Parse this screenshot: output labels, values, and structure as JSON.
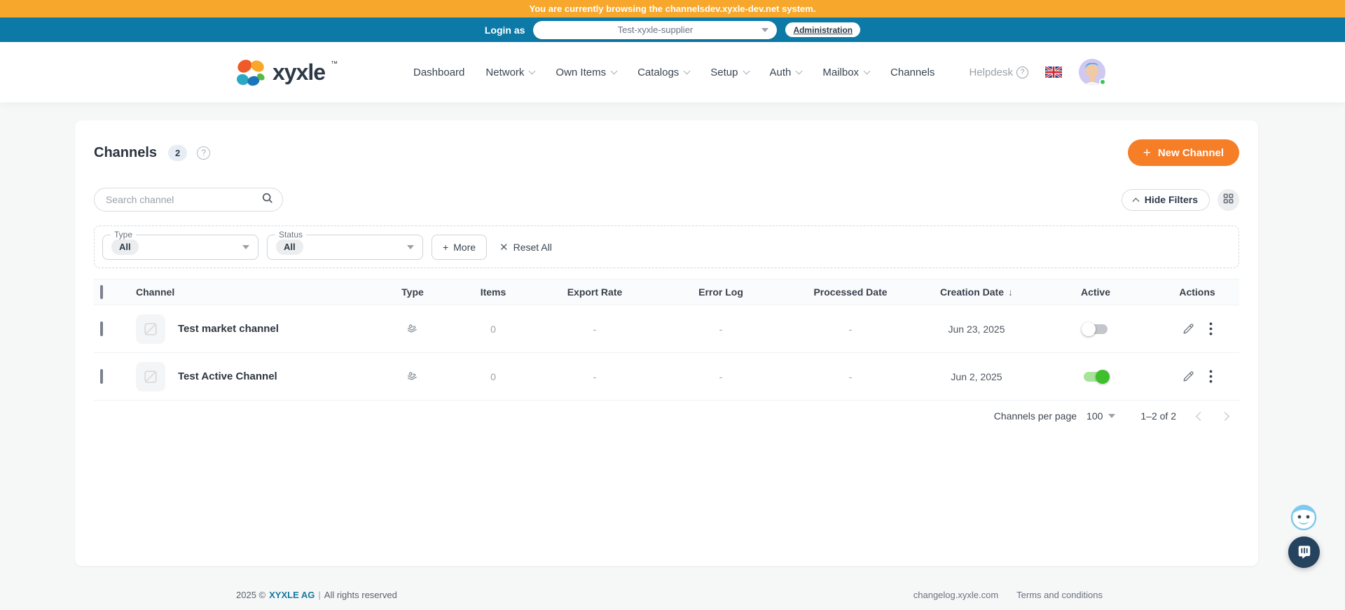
{
  "banner": {
    "text": "You are currently browsing the channelsdev.xyxle-dev.net system."
  },
  "login_bar": {
    "label": "Login as",
    "selected_user": "Test-xyxle-supplier",
    "admin_link": "Administration"
  },
  "header": {
    "logo_text": "xyxle",
    "logo_tm": "™",
    "nav": [
      {
        "label": "Dashboard"
      },
      {
        "label": "Network"
      },
      {
        "label": "Own Items"
      },
      {
        "label": "Catalogs"
      },
      {
        "label": "Setup"
      },
      {
        "label": "Auth"
      },
      {
        "label": "Mailbox"
      },
      {
        "label": "Channels"
      }
    ],
    "helpdesk_label": "Helpdesk"
  },
  "page": {
    "title": "Channels",
    "count_badge": "2"
  },
  "toolbar": {
    "new_channel_label": "New Channel",
    "plus_sign": "+",
    "search_placeholder": "Search channel",
    "hide_filters_label": "Hide Filters"
  },
  "filters": {
    "type_label": "Type",
    "type_value": "All",
    "status_label": "Status",
    "status_value": "All",
    "more_plus": "+",
    "more_label": "More",
    "reset_x": "✕",
    "reset_label": "Reset All"
  },
  "table": {
    "columns": [
      "Channel",
      "Type",
      "Items",
      "Export Rate",
      "Error Log",
      "Processed Date",
      "Creation Date",
      "Active",
      "Actions"
    ],
    "sort_arrow": "↓",
    "rows": [
      {
        "name": "Test market channel",
        "items": "0",
        "export_rate": "-",
        "error_log": "-",
        "processed_date": "-",
        "creation_date": "Jun 23, 2025",
        "active": false
      },
      {
        "name": "Test Active Channel",
        "items": "0",
        "export_rate": "-",
        "error_log": "-",
        "processed_date": "-",
        "creation_date": "Jun 2, 2025",
        "active": true
      }
    ]
  },
  "pagination": {
    "per_page_label": "Channels per page",
    "per_page_value": "100",
    "range_label": "1–2 of 2"
  },
  "footer": {
    "year": "2025 ©",
    "company": "XYXLE AG",
    "pipe": "|",
    "rights": "All rights reserved",
    "changelog": "changelog.xyxle.com",
    "terms": "Terms and conditions"
  },
  "colors": {
    "banner": "#F7A72B",
    "topbar": "#0D79A7",
    "primary_button": "#F57E27",
    "toggle_on": "#3FBE2E",
    "footer_link": "#16799F"
  }
}
